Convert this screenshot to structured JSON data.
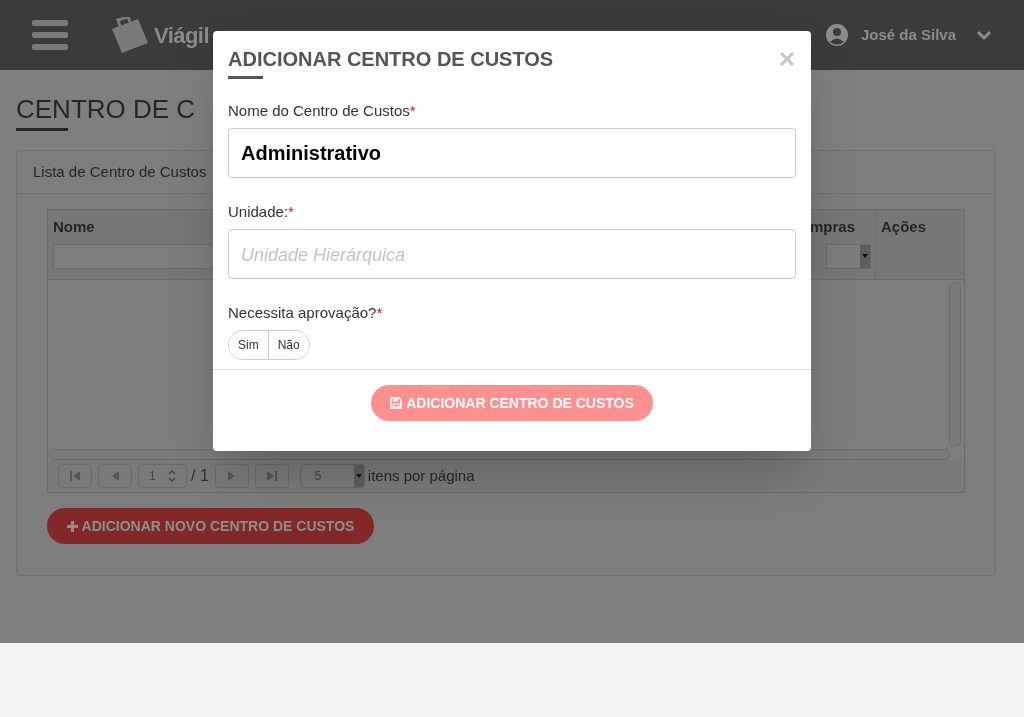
{
  "header": {
    "logo_text": "Viágil",
    "user_name": "José da Silva"
  },
  "page": {
    "title": "CENTRO DE C",
    "panel_title": "Lista de Centro de Custos",
    "table": {
      "columns": [
        {
          "label": "Nome",
          "kind": "text"
        },
        {
          "label": "mpras",
          "kind": "select"
        },
        {
          "label": "Ações",
          "kind": "none"
        }
      ]
    },
    "pager": {
      "page": "1",
      "total": "/ 1",
      "page_size": "5",
      "page_size_label": "itens por página"
    },
    "add_button": "ADICIONAR NOVO CENTRO DE CUSTOS"
  },
  "modal": {
    "title": "ADICIONAR CENTRO DE CUSTOS",
    "fields": [
      {
        "kind": "text",
        "label": "Nome do Centro de Custos",
        "required_mark": "*",
        "value": "Administrativo"
      },
      {
        "kind": "text",
        "label": "Unidade:",
        "required_mark": "*",
        "placeholder": "Unidade Hierárquica"
      },
      {
        "kind": "toggle",
        "label": "Necessita aprovação?",
        "required_mark": "*",
        "options": [
          {
            "label": "Sim",
            "selected": false
          },
          {
            "label": "Não",
            "selected": false
          }
        ]
      }
    ],
    "submit": {
      "label": "ADICIONAR CENTRO DE CUSTOS",
      "disabled": true
    }
  }
}
